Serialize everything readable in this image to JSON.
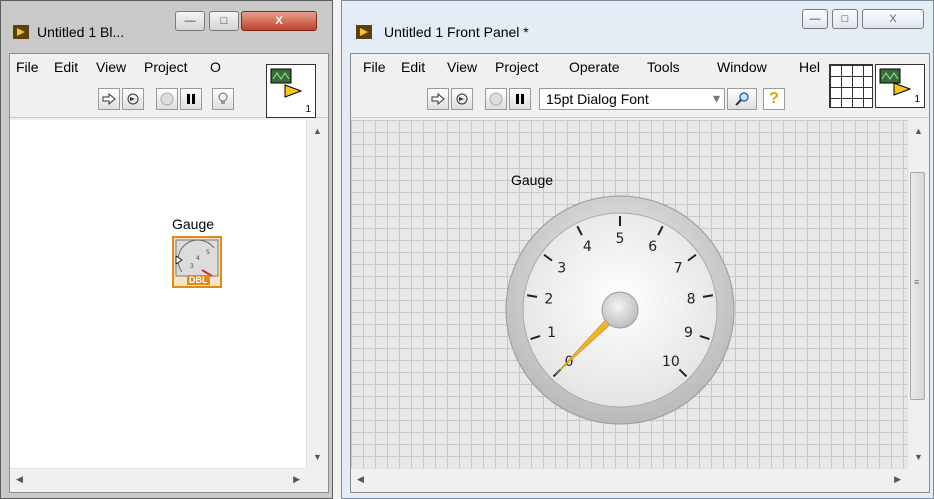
{
  "block_diagram": {
    "title": "Untitled 1 Bl...",
    "menus": [
      "File",
      "Edit",
      "View",
      "Project",
      "O"
    ],
    "caption": {
      "minimize": "—",
      "maximize": "□",
      "close": "X"
    },
    "terminal": {
      "label": "Gauge",
      "type_badge": "DBL"
    },
    "connector_number": "1"
  },
  "front_panel": {
    "title": "Untitled 1 Front Panel *",
    "menus": [
      "File",
      "Edit",
      "View",
      "Project",
      "Operate",
      "Tools",
      "Window",
      "Hel"
    ],
    "caption": {
      "minimize": "—",
      "maximize": "□",
      "close": "X"
    },
    "font_selector": "15pt Dialog Font",
    "help_glyph": "?",
    "connector_number": "1",
    "gauge": {
      "label": "Gauge",
      "scale_labels": [
        "0",
        "1",
        "2",
        "3",
        "4",
        "5",
        "6",
        "7",
        "8",
        "9",
        "10"
      ],
      "value": 0,
      "min": 0,
      "max": 10,
      "needle_color": "#f0b429"
    }
  },
  "colors": {
    "run_red": "#e04a3a",
    "gauge_orange": "#e08a1a"
  }
}
